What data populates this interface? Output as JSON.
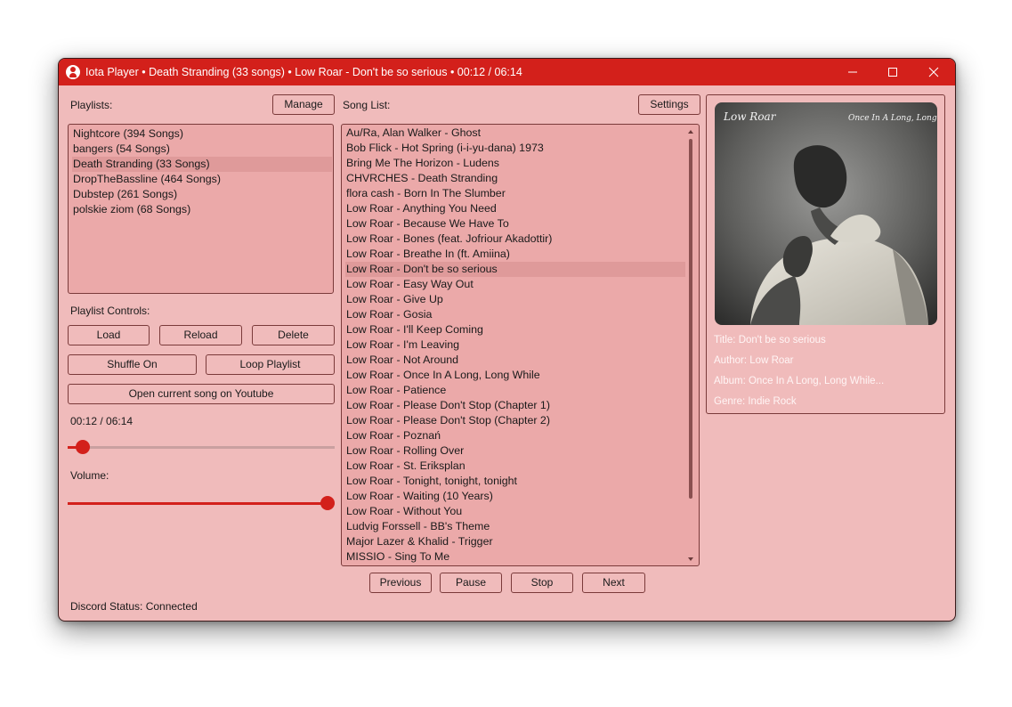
{
  "window": {
    "title": "Iota Player • Death Stranding (33 songs) • Low Roar - Don't be so serious • 00:12 / 06:14",
    "app_icon": "person-icon",
    "controls": {
      "minimize": "minimize-icon",
      "maximize": "maximize-icon",
      "close": "close-icon"
    }
  },
  "colors": {
    "accent": "#d3201b",
    "background": "#f0bbbb",
    "list_background": "#eba9a9",
    "selection": "#df9a9a"
  },
  "playlists": {
    "label": "Playlists:",
    "manage_button": "Manage",
    "items": [
      {
        "label": "Nightcore (394 Songs)",
        "selected": false
      },
      {
        "label": "bangers (54 Songs)",
        "selected": false
      },
      {
        "label": "Death Stranding (33 Songs)",
        "selected": true
      },
      {
        "label": "DropTheBassline (464 Songs)",
        "selected": false
      },
      {
        "label": "Dubstep (261 Songs)",
        "selected": false
      },
      {
        "label": "polskie ziom (68 Songs)",
        "selected": false
      }
    ]
  },
  "controls": {
    "label": "Playlist Controls:",
    "load": "Load",
    "reload": "Reload",
    "delete": "Delete",
    "shuffle": "Shuffle On",
    "loop": "Loop Playlist",
    "youtube": "Open current song on Youtube"
  },
  "progress": {
    "time": "00:12 / 06:14",
    "position": 0.032
  },
  "volume": {
    "label": "Volume:",
    "level": 1.0
  },
  "songs": {
    "label": "Song List:",
    "settings_button": "Settings",
    "items": [
      {
        "label": "Au/Ra, Alan Walker - Ghost",
        "selected": false
      },
      {
        "label": "Bob Flick - Hot Spring (i-i-yu-dana)  1973",
        "selected": false
      },
      {
        "label": "Bring Me The Horizon - Ludens",
        "selected": false
      },
      {
        "label": "CHVRCHES - Death Stranding",
        "selected": false
      },
      {
        "label": "flora cash - Born In The Slumber",
        "selected": false
      },
      {
        "label": "Low Roar - Anything You Need",
        "selected": false
      },
      {
        "label": "Low Roar - Because We Have To",
        "selected": false
      },
      {
        "label": "Low Roar - Bones (feat. Jofriour Akadottir)",
        "selected": false
      },
      {
        "label": "Low Roar - Breathe In (ft. Amiina)",
        "selected": false
      },
      {
        "label": "Low Roar - Don't be so serious",
        "selected": true
      },
      {
        "label": "Low Roar - Easy Way Out",
        "selected": false
      },
      {
        "label": "Low Roar - Give Up",
        "selected": false
      },
      {
        "label": "Low Roar - Gosia",
        "selected": false
      },
      {
        "label": "Low Roar - I'll Keep Coming",
        "selected": false
      },
      {
        "label": "Low Roar - I'm Leaving",
        "selected": false
      },
      {
        "label": "Low Roar - Not Around",
        "selected": false
      },
      {
        "label": "Low Roar - Once In A Long, Long While",
        "selected": false
      },
      {
        "label": "Low Roar - Patience",
        "selected": false
      },
      {
        "label": "Low Roar - Please Don't Stop (Chapter 1)",
        "selected": false
      },
      {
        "label": "Low Roar - Please Don't Stop (Chapter 2)",
        "selected": false
      },
      {
        "label": "Low Roar - Poznań",
        "selected": false
      },
      {
        "label": "Low Roar - Rolling Over",
        "selected": false
      },
      {
        "label": "Low Roar - St. Eriksplan",
        "selected": false
      },
      {
        "label": "Low Roar - Tonight, tonight, tonight",
        "selected": false
      },
      {
        "label": "Low Roar - Waiting (10 Years)",
        "selected": false
      },
      {
        "label": "Low Roar - Without You",
        "selected": false
      },
      {
        "label": "Ludvig Forssell - BB's Theme",
        "selected": false
      },
      {
        "label": "Major Lazer & Khalid - Trigger",
        "selected": false
      },
      {
        "label": "MISSIO - Sing To Me",
        "selected": false
      }
    ]
  },
  "playback": {
    "previous": "Previous",
    "pause": "Pause",
    "stop": "Stop",
    "next": "Next"
  },
  "now_playing": {
    "cover_text_left": "Low Roar",
    "cover_text_right": "Once In A Long, Long While",
    "title": "Title: Don't be so serious",
    "author": "Author: Low Roar",
    "album": "Album: Once In A Long, Long While...",
    "genre": "Genre: Indie Rock"
  },
  "status": {
    "discord": "Discord Status: Connected"
  }
}
